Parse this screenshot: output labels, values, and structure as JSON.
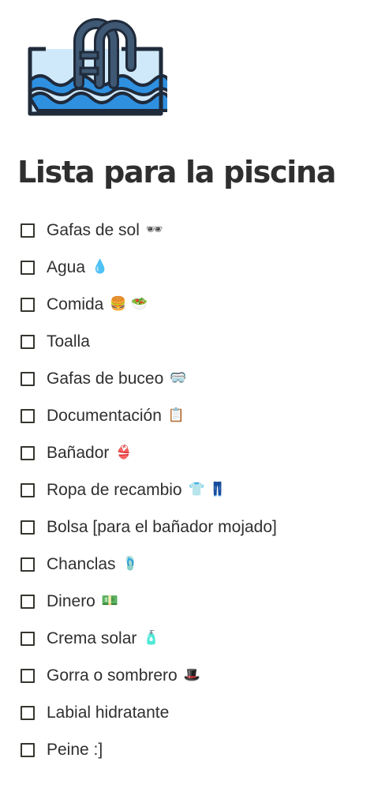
{
  "page": {
    "icon": "swimming-pool-icon",
    "title": "Lista para la piscina"
  },
  "checklist": [
    {
      "label": "Gafas de sol",
      "emoji": "🕶",
      "checked": false
    },
    {
      "label": "Agua",
      "emoji": "💧",
      "checked": false
    },
    {
      "label": "Comida",
      "emoji": "🍔 🥗",
      "checked": false
    },
    {
      "label": "Toalla",
      "emoji": "",
      "checked": false
    },
    {
      "label": "Gafas de buceo",
      "emoji": "🥽",
      "checked": false
    },
    {
      "label": "Documentación",
      "emoji": "📋",
      "checked": false
    },
    {
      "label": "Bañador",
      "emoji": "👙",
      "checked": false
    },
    {
      "label": "Ropa de recambio",
      "emoji": "👕 👖",
      "checked": false
    },
    {
      "label": "Bolsa [para el bañador mojado]",
      "emoji": "",
      "checked": false
    },
    {
      "label": "Chanclas",
      "emoji": "🩴",
      "checked": false
    },
    {
      "label": "Dinero",
      "emoji": "💵",
      "checked": false
    },
    {
      "label": "Crema solar",
      "emoji": "🧴",
      "checked": false
    },
    {
      "label": "Gorra o sombrero",
      "emoji": "🎩",
      "checked": false
    },
    {
      "label": "Labial hidratante",
      "emoji": "",
      "checked": false
    },
    {
      "label": "Peine :]",
      "emoji": "",
      "checked": false
    }
  ],
  "colors": {
    "text": "#2f2f2f",
    "icon_outline": "#1f2a3a",
    "icon_ladder": "#3f5873",
    "icon_water_light": "#cfe9fb",
    "icon_water": "#2f90e0"
  }
}
